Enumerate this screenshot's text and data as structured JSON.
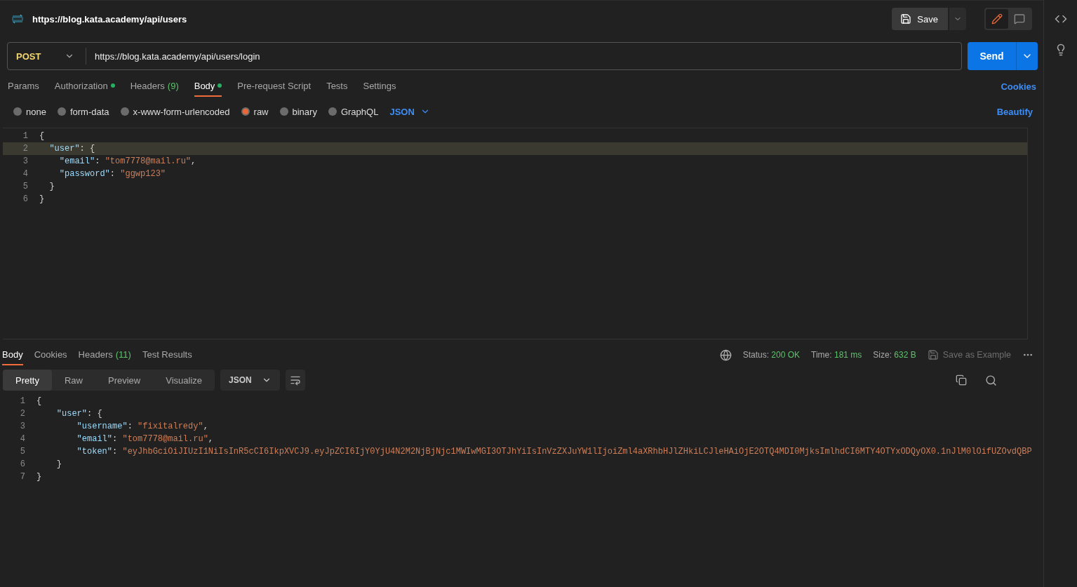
{
  "request": {
    "title": "https://blog.kata.academy/api/users",
    "save_label": "Save",
    "method": "POST",
    "url": "https://blog.kata.academy/api/users/login",
    "send_label": "Send"
  },
  "request_tabs": [
    {
      "label": "Params",
      "selected": false
    },
    {
      "label": "Authorization",
      "selected": false,
      "dot": true
    },
    {
      "label": "Headers",
      "count": "(9)",
      "selected": false
    },
    {
      "label": "Body",
      "selected": true,
      "dot": true
    },
    {
      "label": "Pre-request Script",
      "selected": false
    },
    {
      "label": "Tests",
      "selected": false
    },
    {
      "label": "Settings",
      "selected": false
    }
  ],
  "cookies_link": "Cookies",
  "body_types": [
    {
      "label": "none",
      "selected": false
    },
    {
      "label": "form-data",
      "selected": false
    },
    {
      "label": "x-www-form-urlencoded",
      "selected": false
    },
    {
      "label": "raw",
      "selected": true
    },
    {
      "label": "binary",
      "selected": false
    },
    {
      "label": "GraphQL",
      "selected": false
    }
  ],
  "body_format": "JSON",
  "beautify_link": "Beautify",
  "request_body": [
    {
      "number": "1",
      "highlighted": false,
      "tokens": [
        {
          "kind": "punct",
          "text": "{"
        }
      ]
    },
    {
      "number": "2",
      "highlighted": true,
      "tokens": [
        {
          "kind": "key",
          "text": "  \"user\""
        },
        {
          "kind": "punct",
          "text": ": {"
        }
      ]
    },
    {
      "number": "3",
      "highlighted": false,
      "tokens": [
        {
          "kind": "key",
          "text": "    \"email\""
        },
        {
          "kind": "punct",
          "text": ": "
        },
        {
          "kind": "string",
          "text": "\"tom7778@mail.ru\""
        },
        {
          "kind": "punct",
          "text": ","
        }
      ]
    },
    {
      "number": "4",
      "highlighted": false,
      "tokens": [
        {
          "kind": "key",
          "text": "    \"password\""
        },
        {
          "kind": "punct",
          "text": ": "
        },
        {
          "kind": "string",
          "text": "\"ggwp123\""
        }
      ]
    },
    {
      "number": "5",
      "highlighted": false,
      "tokens": [
        {
          "kind": "punct",
          "text": "  }"
        }
      ]
    },
    {
      "number": "6",
      "highlighted": false,
      "tokens": [
        {
          "kind": "punct",
          "text": "}"
        }
      ]
    }
  ],
  "response_tabs": [
    {
      "label": "Body",
      "selected": true
    },
    {
      "label": "Cookies",
      "selected": false
    },
    {
      "label": "Headers",
      "count": "(11)",
      "selected": false
    },
    {
      "label": "Test Results",
      "selected": false
    }
  ],
  "response_meta": [
    {
      "label": "Status:",
      "value": "200 OK"
    },
    {
      "label": "Time:",
      "value": "181 ms"
    },
    {
      "label": "Size:",
      "value": "632 B"
    }
  ],
  "save_example_label": "Save as Example",
  "view_modes": [
    {
      "label": "Pretty",
      "selected": true
    },
    {
      "label": "Raw",
      "selected": false
    },
    {
      "label": "Preview",
      "selected": false
    },
    {
      "label": "Visualize",
      "selected": false
    }
  ],
  "response_format": "JSON",
  "response_body": [
    {
      "number": "1",
      "tokens": [
        {
          "kind": "punct",
          "text": "{"
        }
      ]
    },
    {
      "number": "2",
      "tokens": [
        {
          "kind": "key",
          "text": "    \"user\""
        },
        {
          "kind": "punct",
          "text": ": {"
        }
      ]
    },
    {
      "number": "3",
      "tokens": [
        {
          "kind": "key",
          "text": "        \"username\""
        },
        {
          "kind": "punct",
          "text": ": "
        },
        {
          "kind": "string",
          "text": "\"fixitalredy\""
        },
        {
          "kind": "punct",
          "text": ","
        }
      ]
    },
    {
      "number": "4",
      "tokens": [
        {
          "kind": "key",
          "text": "        \"email\""
        },
        {
          "kind": "punct",
          "text": ": "
        },
        {
          "kind": "string",
          "text": "\"tom7778@mail.ru\""
        },
        {
          "kind": "punct",
          "text": ","
        }
      ]
    },
    {
      "number": "5",
      "tokens": [
        {
          "kind": "key",
          "text": "        \"token\""
        },
        {
          "kind": "punct",
          "text": ": "
        },
        {
          "kind": "string",
          "text": "\"eyJhbGciOiJIUzI1NiIsInR5cCI6IkpXVCJ9.eyJpZCI6IjY0YjU4N2M2NjBjNjc1MWIwMGI3OTJhYiIsInVzZXJuYW1lIjoiZml4aXRhbHJlZHkiLCJleHAiOjE2OTQ4MDI0MjksImlhdCI6MTY4OTYxODQyOX0.1nJlM0lOifUZOvdQBP"
        }
      ]
    },
    {
      "number": "6",
      "tokens": [
        {
          "kind": "punct",
          "text": "    }"
        }
      ]
    },
    {
      "number": "7",
      "tokens": [
        {
          "kind": "punct",
          "text": "}"
        }
      ]
    }
  ]
}
